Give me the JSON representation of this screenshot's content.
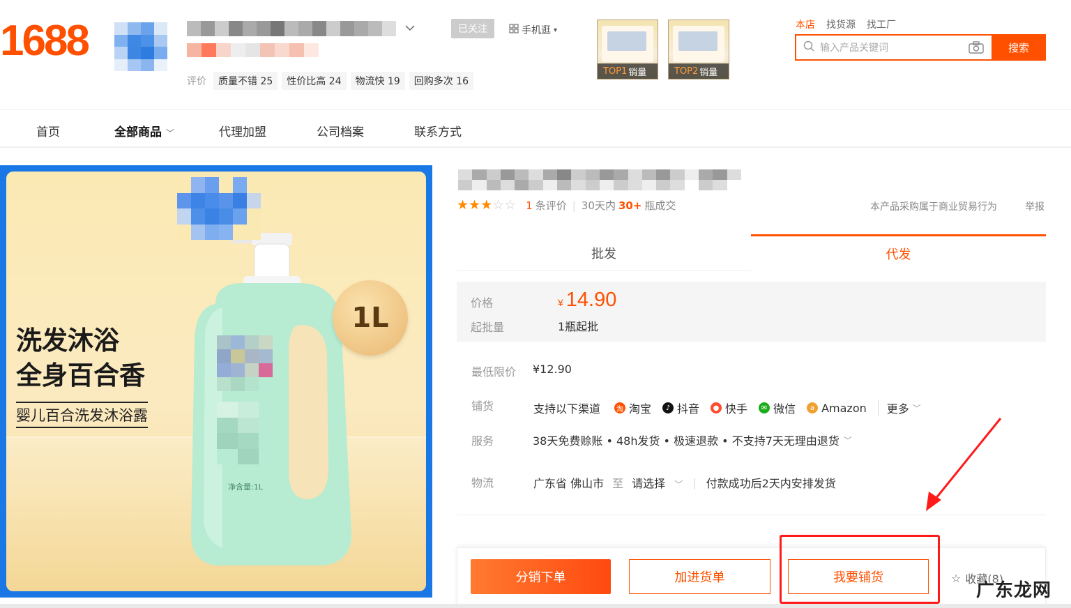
{
  "header": {
    "logo": "1688",
    "follow_label": "已关注",
    "mobile_label": "手机逛",
    "review_label": "评价",
    "review_tags": [
      "质量不错 25",
      "性价比高 24",
      "物流快 19",
      "回购多次 16"
    ],
    "top_products": [
      {
        "rank": "TOP1",
        "label": "销量"
      },
      {
        "rank": "TOP2",
        "label": "销量"
      }
    ],
    "scope_tabs": [
      "本店",
      "找货源",
      "找工厂"
    ],
    "search_placeholder": "输入产品关键词",
    "search_button": "搜索"
  },
  "nav": {
    "items": [
      "首页",
      "全部商品",
      "代理加盟",
      "公司档案",
      "联系方式"
    ]
  },
  "product_image": {
    "headline_line1": "洗发沐浴",
    "headline_line2": "全身百合香",
    "subtitle": "婴儿百合洗发沐浴露",
    "volume_badge": "1L",
    "bottle_volume": "净含量:1L"
  },
  "product": {
    "rating_stars": 3,
    "rating_max": 5,
    "review_count": "1",
    "review_suffix": "条评价",
    "sales_prefix": "30天内",
    "sales_count": "30+",
    "sales_suffix": "瓶成交",
    "trade_note": "本产品采购属于商业贸易行为",
    "report": "举报",
    "tabs": [
      "批发",
      "代发"
    ],
    "active_tab": "代发",
    "price_label": "价格",
    "currency": "¥",
    "price": "14.90",
    "moq_label": "起批量",
    "moq": "1瓶起批",
    "min_price_label": "最低限价",
    "min_price": "¥12.90",
    "distribution_label": "铺货",
    "distribution_intro": "支持以下渠道",
    "channels": [
      "淘宝",
      "抖音",
      "快手",
      "微信",
      "Amazon",
      "更多"
    ],
    "service_label": "服务",
    "services": "38天免费赊账 • 48h发货 • 极速退款 • 不支持7天无理由退货",
    "logistics_label": "物流",
    "origin": "广东省 佛山市",
    "to": "至",
    "destination": "请选择",
    "shipping_note": "付款成功后2天内安排发货"
  },
  "actions": {
    "order": "分销下单",
    "cart": "加进货单",
    "list": "我要铺货",
    "favorite": "收藏(8)"
  },
  "watermark": "广东龙网",
  "colors": {
    "brand": "#ff5000",
    "annotation": "#ff1a1a",
    "image_frame": "#1a78e6"
  }
}
